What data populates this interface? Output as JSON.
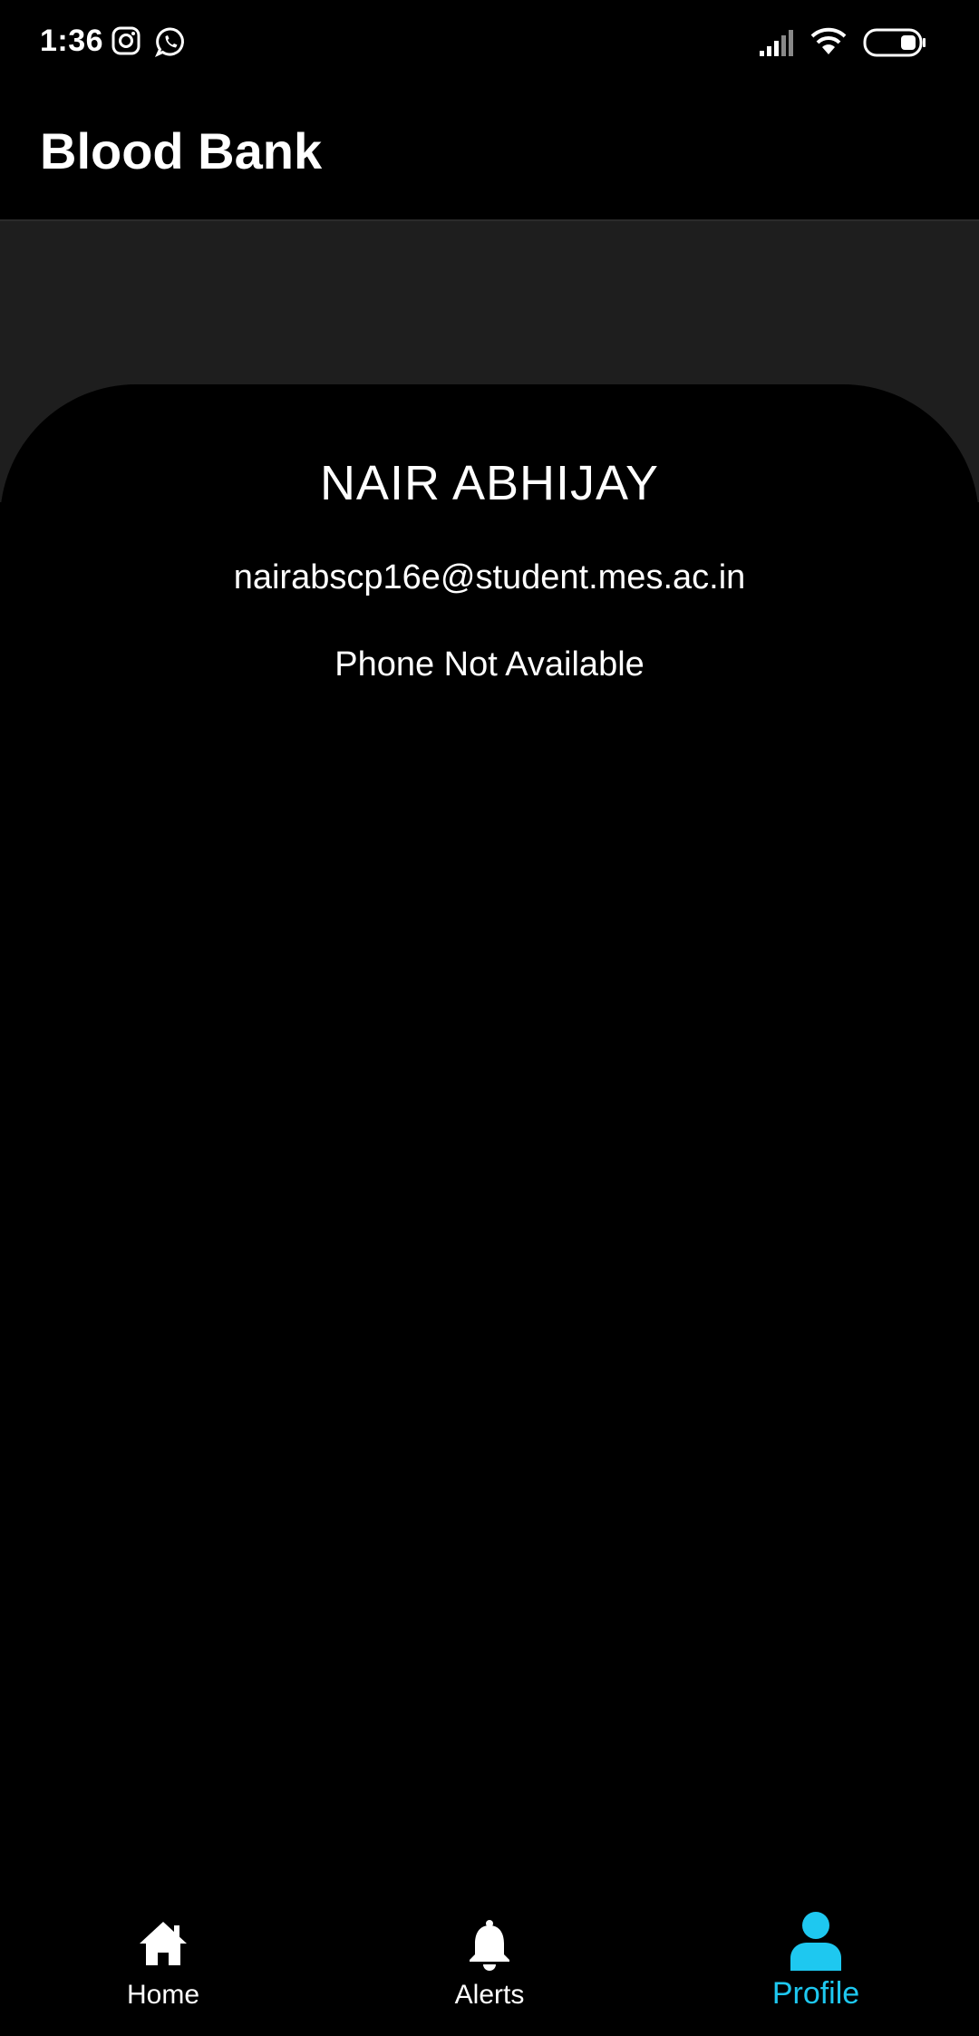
{
  "status_bar": {
    "time": "1:36",
    "left_icons": [
      "instagram-icon",
      "whatsapp-icon"
    ],
    "right_icons": [
      "cellular-signal-icon",
      "wifi-icon",
      "battery-icon"
    ]
  },
  "app_bar": {
    "title": "Blood Bank"
  },
  "profile": {
    "name": "NAIR ABHIJAY",
    "email": "nairabscp16e@student.mes.ac.in",
    "phone": "Phone Not Available"
  },
  "bottom_nav": {
    "items": [
      {
        "label": "Home",
        "icon": "home-icon",
        "active": false
      },
      {
        "label": "Alerts",
        "icon": "bell-icon",
        "active": false
      },
      {
        "label": "Profile",
        "icon": "person-icon",
        "active": true
      }
    ]
  },
  "colors": {
    "background": "#000000",
    "header_band": "#1e1e1e",
    "accent": "#1ec8f0",
    "text": "#ffffff"
  }
}
